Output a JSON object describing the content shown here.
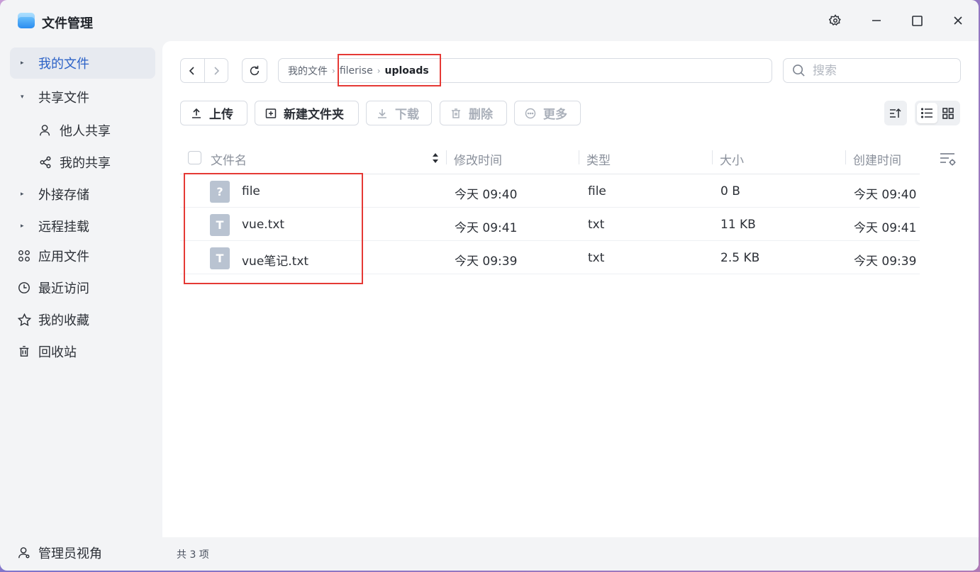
{
  "app": {
    "title": "文件管理"
  },
  "window_controls": {
    "settings_icon": "gear-icon",
    "maximize_icon": "square-icon",
    "close_icon": "close-icon"
  },
  "sidebar": {
    "items": [
      {
        "label": "我的文件",
        "type": "caret",
        "active": true
      },
      {
        "label": "共享文件",
        "type": "caret-open"
      },
      {
        "label": "他人共享",
        "type": "sub",
        "icon": "user-icon"
      },
      {
        "label": "我的共享",
        "type": "sub",
        "icon": "share-icon"
      },
      {
        "label": "外接存储",
        "type": "caret"
      },
      {
        "label": "远程挂载",
        "type": "caret"
      },
      {
        "label": "应用文件",
        "type": "icon",
        "icon": "apps-grid-icon"
      },
      {
        "label": "最近访问",
        "type": "icon",
        "icon": "clock-icon"
      },
      {
        "label": "我的收藏",
        "type": "icon",
        "icon": "star-icon"
      },
      {
        "label": "回收站",
        "type": "icon",
        "icon": "trash-icon"
      }
    ],
    "admin_label": "管理员视角"
  },
  "breadcrumb": {
    "root": "我的文件",
    "parent": "filerise",
    "current": "uploads"
  },
  "search": {
    "placeholder": "搜索"
  },
  "toolbar": {
    "upload": "上传",
    "new_folder": "新建文件夹",
    "download": "下载",
    "delete": "删除",
    "more": "更多"
  },
  "table": {
    "columns": {
      "name": "文件名",
      "modified": "修改时间",
      "type": "类型",
      "size": "大小",
      "created": "创建时间"
    },
    "rows": [
      {
        "icon": "unknown-file-icon",
        "name": "file",
        "modified": "今天 09:40",
        "type": "file",
        "size": "0 B",
        "created": "今天 09:40"
      },
      {
        "icon": "text-file-icon",
        "name": "vue.txt",
        "modified": "今天 09:41",
        "type": "txt",
        "size": "11 KB",
        "created": "今天 09:41"
      },
      {
        "icon": "text-file-icon",
        "name": "vue笔记.txt",
        "modified": "今天 09:39",
        "type": "txt",
        "size": "2.5 KB",
        "created": "今天 09:39"
      }
    ]
  },
  "status": {
    "count_text": "共 3 项"
  },
  "colors": {
    "accent": "#2c62c7",
    "highlight": "#e53935"
  }
}
